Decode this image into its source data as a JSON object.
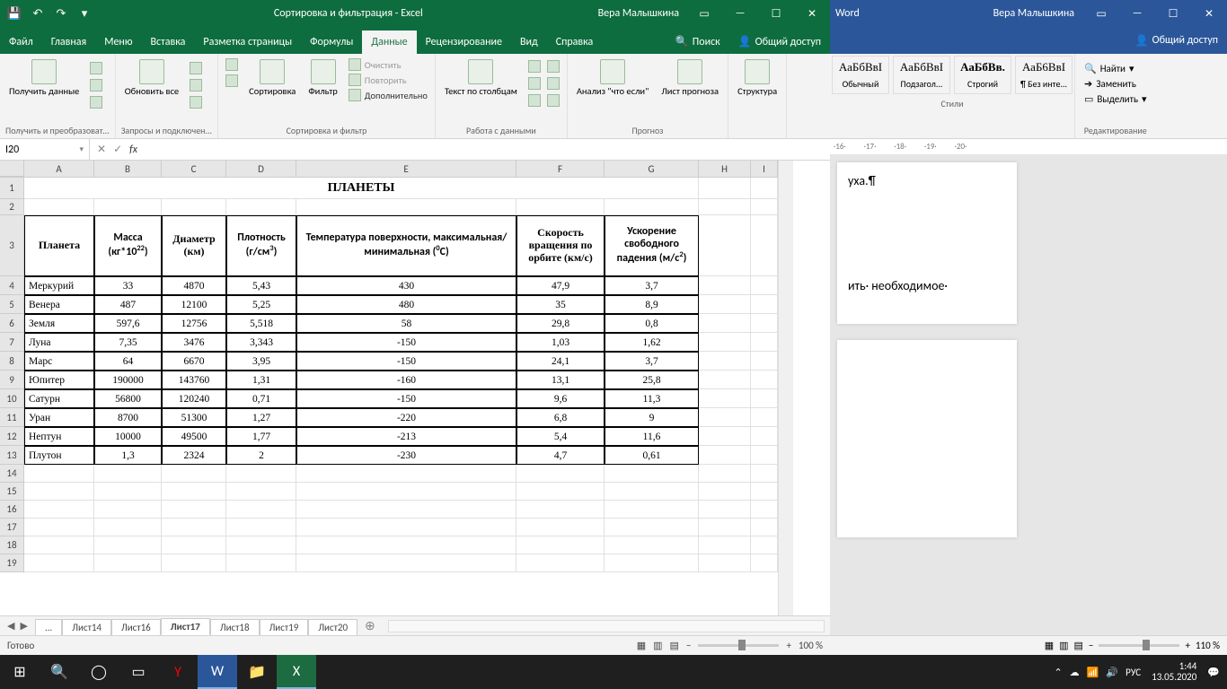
{
  "excel": {
    "title": "Сортировка и фильтрация  -  Excel",
    "user": "Вера Малышкина",
    "tabs": {
      "file": "Файл",
      "home": "Главная",
      "menu": "Меню",
      "insert": "Вставка",
      "pagelayout": "Разметка страницы",
      "formulas": "Формулы",
      "data": "Данные",
      "review": "Рецензирование",
      "view": "Вид",
      "help": "Справка",
      "search": "Поиск",
      "share": "Общий доступ"
    },
    "ribbon": {
      "get_data": "Получить данные",
      "get_transform": "Получить и преобразоват...",
      "refresh": "Обновить все",
      "queries": "Запросы и подключен...",
      "sort": "Сортировка",
      "filter": "Фильтр",
      "clear": "Очистить",
      "reapply": "Повторить",
      "advanced": "Дополнительно",
      "sort_filter": "Сортировка и фильтр",
      "text_cols": "Текст по столбцам",
      "data_tools": "Работа с данными",
      "whatif": "Анализ \"что если\"",
      "forecast_sheet": "Лист прогноза",
      "forecast": "Прогноз",
      "outline": "Структура"
    },
    "namebox": "I20",
    "cols": [
      "A",
      "B",
      "C",
      "D",
      "E",
      "F",
      "G",
      "H",
      "I"
    ],
    "rows_blank": [
      14,
      15,
      16,
      17,
      18,
      19
    ],
    "sheet_title": "ПЛАНЕТЫ",
    "headers": {
      "planet": "Планета",
      "mass": "Масса (кг*10",
      "mass_sup": "22",
      "mass_end": ")",
      "diameter": "Диаметр (км)",
      "density": "Плотность (г/см",
      "density_sup": "3",
      "density_end": ")",
      "temp": "Температура поверхности, максимальная/минимальная (",
      "temp_sup": "0",
      "temp_end": "С)",
      "velocity": "Скорость вращения по орбите (км/с)",
      "gravity": "Ускорение свободного падения (м/с",
      "gravity_sup": "2",
      "gravity_end": ")"
    },
    "data_rows": [
      {
        "n": 4,
        "a": "Меркурий",
        "b": "33",
        "c": "4870",
        "d": "5,43",
        "e": "430",
        "f": "47,9",
        "g": "3,7"
      },
      {
        "n": 5,
        "a": "Венера",
        "b": "487",
        "c": "12100",
        "d": "5,25",
        "e": "480",
        "f": "35",
        "g": "8,9"
      },
      {
        "n": 6,
        "a": "Земля",
        "b": "597,6",
        "c": "12756",
        "d": "5,518",
        "e": "58",
        "f": "29,8",
        "g": "0,8"
      },
      {
        "n": 7,
        "a": "Луна",
        "b": "7,35",
        "c": "3476",
        "d": "3,343",
        "e": "-150",
        "f": "1,03",
        "g": "1,62"
      },
      {
        "n": 8,
        "a": "Марс",
        "b": "64",
        "c": "6670",
        "d": "3,95",
        "e": "-150",
        "f": "24,1",
        "g": "3,7"
      },
      {
        "n": 9,
        "a": "Юпитер",
        "b": "190000",
        "c": "143760",
        "d": "1,31",
        "e": "-160",
        "f": "13,1",
        "g": "25,8"
      },
      {
        "n": 10,
        "a": "Сатурн",
        "b": "56800",
        "c": "120240",
        "d": "0,71",
        "e": "-150",
        "f": "9,6",
        "g": "11,3"
      },
      {
        "n": 11,
        "a": "Уран",
        "b": "8700",
        "c": "51300",
        "d": "1,27",
        "e": "-220",
        "f": "6,8",
        "g": "9"
      },
      {
        "n": 12,
        "a": "Нептун",
        "b": "10000",
        "c": "49500",
        "d": "1,77",
        "e": "-213",
        "f": "5,4",
        "g": "11,6"
      },
      {
        "n": 13,
        "a": "Плутон",
        "b": "1,3",
        "c": "2324",
        "d": "2",
        "e": "-230",
        "f": "4,7",
        "g": "0,61"
      }
    ],
    "sheets": {
      "more": "...",
      "s14": "Лист14",
      "s16": "Лист16",
      "s17": "Лист17",
      "s18": "Лист18",
      "s19": "Лист19",
      "s20": "Лист20"
    },
    "status_ready": "Готово",
    "zoom": "100 %"
  },
  "word": {
    "app": "Word",
    "user": "Вера Малышкина",
    "share": "Общий доступ",
    "styles": {
      "heading": "Обычный",
      "subtitle": "Подзагол...",
      "strong": "Строгий",
      "nospace": "¶ Без инте...",
      "preview_text": "АаБбВвІ",
      "preview_bold": "АаБбВв.",
      "preview_caps": "АаБ6ВвI"
    },
    "styles_label": "Стили",
    "editing": {
      "find": "Найти",
      "replace": "Заменить",
      "select": "Выделить",
      "label": "Редактирование"
    },
    "doc": {
      "frag1": "уха.¶",
      "frag2": "ить· необходимое·"
    },
    "zoom": "110 %"
  },
  "taskbar": {
    "lang": "РУС",
    "time": "1:44",
    "date": "13.05.2020"
  },
  "chart_data": {
    "type": "table",
    "title": "ПЛАНЕТЫ",
    "columns": [
      "Планета",
      "Масса (кг*10^22)",
      "Диаметр (км)",
      "Плотность (г/см^3)",
      "Температура поверхности (°C)",
      "Скорость вращения по орбите (км/с)",
      "Ускорение свободного падения (м/с^2)"
    ],
    "rows": [
      [
        "Меркурий",
        33,
        4870,
        5.43,
        430,
        47.9,
        3.7
      ],
      [
        "Венера",
        487,
        12100,
        5.25,
        480,
        35,
        8.9
      ],
      [
        "Земля",
        597.6,
        12756,
        5.518,
        58,
        29.8,
        0.8
      ],
      [
        "Луна",
        7.35,
        3476,
        3.343,
        -150,
        1.03,
        1.62
      ],
      [
        "Марс",
        64,
        6670,
        3.95,
        -150,
        24.1,
        3.7
      ],
      [
        "Юпитер",
        190000,
        143760,
        1.31,
        -160,
        13.1,
        25.8
      ],
      [
        "Сатурн",
        56800,
        120240,
        0.71,
        -150,
        9.6,
        11.3
      ],
      [
        "Уран",
        8700,
        51300,
        1.27,
        -220,
        6.8,
        9
      ],
      [
        "Нептун",
        10000,
        49500,
        1.77,
        -213,
        5.4,
        11.6
      ],
      [
        "Плутон",
        1.3,
        2324,
        2,
        -230,
        4.7,
        0.61
      ]
    ]
  }
}
